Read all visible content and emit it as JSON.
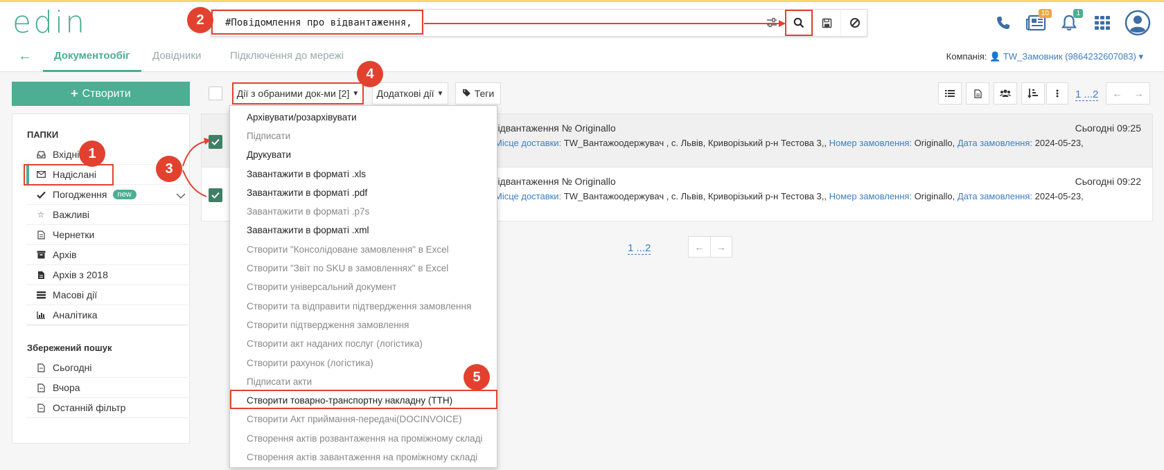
{
  "app": {
    "logo": "edin"
  },
  "search": {
    "value": "#Повідомлення про відвантаження,"
  },
  "header": {
    "news_badge": "10",
    "notif_badge": "1"
  },
  "nav": {
    "tabs": [
      {
        "label": "Документообіг",
        "active": true
      },
      {
        "label": "Довідники",
        "active": false
      },
      {
        "label": "Підключення до мережі",
        "active": false
      }
    ],
    "company_label": "Компанія:",
    "company_value": "TW_Замовник (9864232607083)"
  },
  "sidebar": {
    "create_label": "Створити",
    "folders_heading": "ПАПКИ",
    "items": [
      {
        "label": "Вхідні",
        "icon": "inbox-icon"
      },
      {
        "label": "Надіслані",
        "icon": "envelope-icon",
        "active": true
      },
      {
        "label": "Погодження",
        "icon": "check-icon",
        "badge": "new"
      },
      {
        "label": "Важливі",
        "icon": "star-icon"
      },
      {
        "label": "Чернетки",
        "icon": "draft-icon"
      },
      {
        "label": "Архів",
        "icon": "archive-icon"
      },
      {
        "label": "Архів з 2018",
        "icon": "file-icon"
      },
      {
        "label": "Масові дії",
        "icon": "list-icon"
      },
      {
        "label": "Аналітика",
        "icon": "chart-icon"
      }
    ],
    "saved_heading": "Збережений пошук",
    "saved": [
      {
        "label": "Сьогодні"
      },
      {
        "label": "Вчора"
      },
      {
        "label": "Останній фільтр"
      }
    ]
  },
  "toolbar": {
    "actions_label": "Дії з обраними док-ми [2]",
    "extra_label": "Додаткові дії",
    "tags_label": "Теги",
    "pager": "1 ...2"
  },
  "documents": [
    {
      "title": "відвантаження № Originallo",
      "delivery_key": "Місце доставки:",
      "delivery_val": " TW_Вантажоодержувач , с. Львів, Криворізький р-н Тестова 3,,",
      "order_key": "Номер замовлення:",
      "order_val": " Originallo,",
      "date_key": "Дата замовлення:",
      "date_val": " 2024-05-23,",
      "time": "Сьогодні 09:25"
    },
    {
      "title": "відвантаження № Originallo",
      "delivery_key": "Місце доставки:",
      "delivery_val": " TW_Вантажоодержувач , с. Львів, Криворізький р-н Тестова 3,,",
      "order_key": "Номер замовлення:",
      "order_val": " Originallo,",
      "date_key": "Дата замовлення:",
      "date_val": " 2024-05-23,",
      "time": "Сьогодні 09:22"
    }
  ],
  "bottom_pager": "1 ...2",
  "dropdown": {
    "items": [
      {
        "label": "Архівувати/розархівувати",
        "enabled": true
      },
      {
        "label": "Підписати",
        "enabled": false
      },
      {
        "label": "Друкувати",
        "enabled": true
      },
      {
        "label": "Завантажити в форматі .xls",
        "enabled": true
      },
      {
        "label": "Завантажити в форматі .pdf",
        "enabled": true
      },
      {
        "label": "Завантажити в форматі .p7s",
        "enabled": false
      },
      {
        "label": "Завантажити в форматі .xml",
        "enabled": true
      },
      {
        "label": "Створити \"Консолідоване замовлення\" в Excel",
        "enabled": false
      },
      {
        "label": "Створити \"Звіт по SKU в замовленнях\" в Excel",
        "enabled": false
      },
      {
        "label": "Створити універсальний документ",
        "enabled": false
      },
      {
        "label": "Створити та відправити підтвердження замовлення",
        "enabled": false
      },
      {
        "label": "Створити підтвердження замовлення",
        "enabled": false
      },
      {
        "label": "Створити акт наданих послуг (логістика)",
        "enabled": false
      },
      {
        "label": "Створити рахунок (логістика)",
        "enabled": false
      },
      {
        "label": "Підписати акти",
        "enabled": false
      },
      {
        "label": "Створити товарно-транспортну накладну (ТТН)",
        "enabled": true,
        "highlighted": true
      },
      {
        "label": "Створити Акт приймання-передачі(DOCINVOICE)",
        "enabled": false
      },
      {
        "label": "Створення актів розвантаження на проміжному складі",
        "enabled": false
      },
      {
        "label": "Створення актів завантаження на проміжному складі",
        "enabled": false
      }
    ]
  },
  "annotations": [
    "1",
    "2",
    "3",
    "4",
    "5"
  ],
  "colors": {
    "accent": "#4cae92",
    "link": "#3d7ec1",
    "annotation": "#e2412f"
  }
}
